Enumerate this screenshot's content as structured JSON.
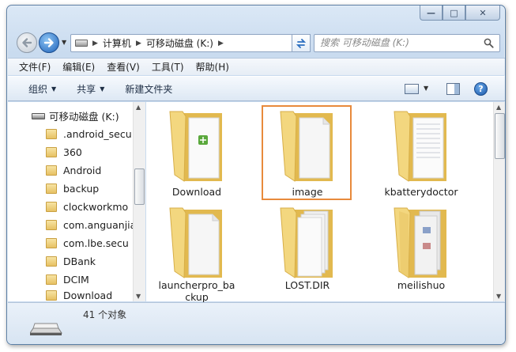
{
  "window": {
    "caption": {
      "minimize": "—",
      "maximize": "□",
      "close": "✕"
    }
  },
  "address": {
    "crumbs": [
      "计算机",
      "可移动磁盘 (K:)"
    ],
    "search_placeholder": "搜索 可移动磁盘 (K:)"
  },
  "menubar": {
    "items": [
      "文件(F)",
      "编辑(E)",
      "查看(V)",
      "工具(T)",
      "帮助(H)"
    ]
  },
  "commandbar": {
    "organize": "组织",
    "share": "共享",
    "new_folder": "新建文件夹",
    "help": "?"
  },
  "navpane": {
    "drive": "可移动磁盘 (K:)",
    "folders": [
      ".android_secu",
      "360",
      "Android",
      "backup",
      "clockworkmo",
      "com.anguanjia",
      "com.lbe.secu",
      "DBank",
      "DCIM",
      "Download"
    ]
  },
  "content": {
    "items": [
      {
        "name": "Download",
        "type": "folder-with-apk"
      },
      {
        "name": "image",
        "type": "folder-empty-page",
        "selected": true
      },
      {
        "name": "kbatterydoctor",
        "type": "folder-doc"
      },
      {
        "name": "launcherpro_backup",
        "line1": "launcherpro_ba",
        "line2": "ckup",
        "type": "folder-empty-page"
      },
      {
        "name": "LOST.DIR",
        "type": "folder-pages"
      },
      {
        "name": "meilishuo",
        "type": "folder-many"
      }
    ]
  },
  "status": {
    "count_text": "41 个对象"
  },
  "colors": {
    "selection_border": "#e88a3c",
    "window_frame": "#c9dbef"
  }
}
